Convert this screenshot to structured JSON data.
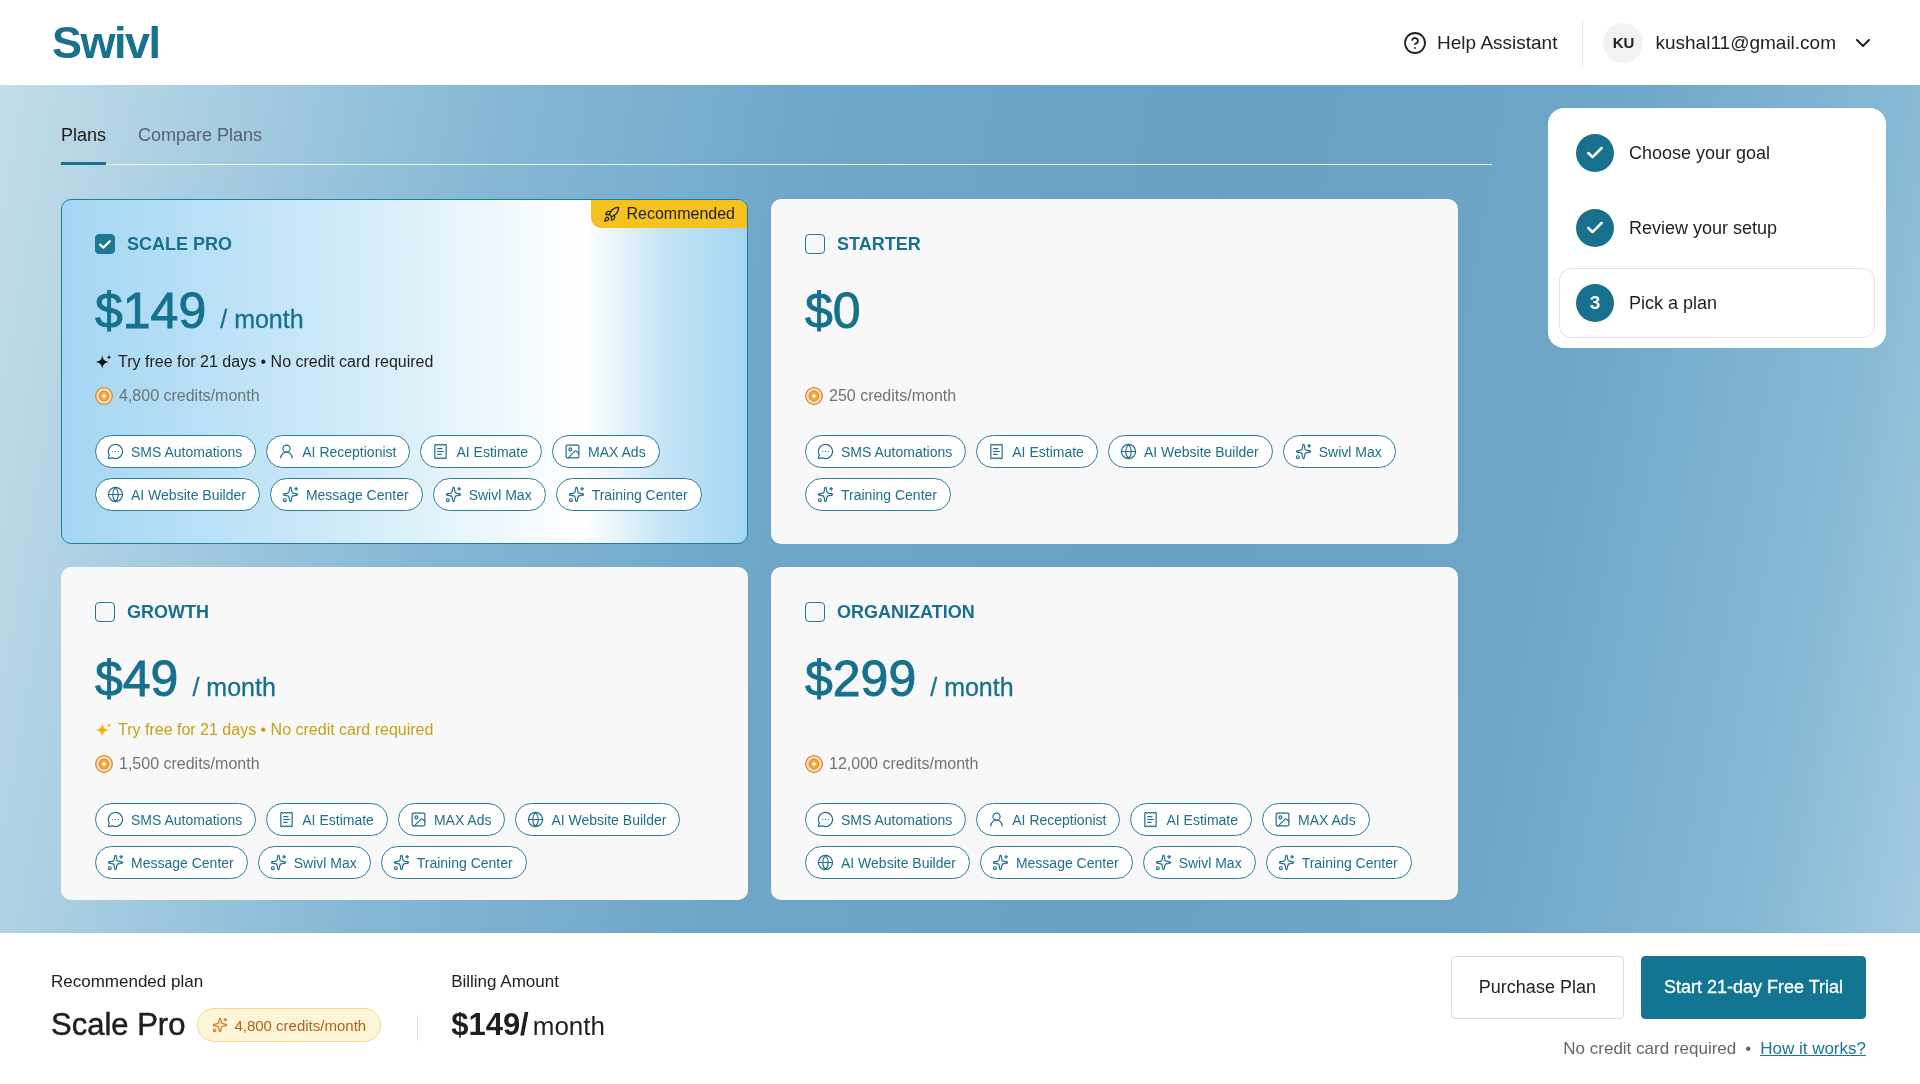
{
  "header": {
    "logo": "Swivl",
    "help": {
      "label": "Help Assistant"
    },
    "user": {
      "initials": "KU",
      "email": "kushal11@gmail.com"
    }
  },
  "tabs": [
    {
      "label": "Plans",
      "selected": true
    },
    {
      "label": "Compare Plans",
      "selected": false
    }
  ],
  "plans": [
    {
      "name": "SCALE PRO",
      "selected": true,
      "badge": "Recommended",
      "price": "$149",
      "period": "/ month",
      "trial": "Try free for 21 days • No credit card required",
      "credits": "4,800 credits/month",
      "features": [
        {
          "label": "SMS Automations",
          "kind": "chat"
        },
        {
          "label": "AI Receptionist",
          "kind": "receptionist"
        },
        {
          "label": "AI Estimate",
          "kind": "estimate"
        },
        {
          "label": "MAX Ads",
          "kind": "ads"
        },
        {
          "label": "AI Website Builder",
          "kind": "website"
        },
        {
          "label": "Message Center",
          "kind": "sparkle"
        },
        {
          "label": "Swivl Max",
          "kind": "sparkle"
        },
        {
          "label": "Training Center",
          "kind": "sparkle"
        }
      ]
    },
    {
      "name": "STARTER",
      "selected": false,
      "price": "$0",
      "credits": "250 credits/month",
      "features": [
        {
          "label": "SMS Automations",
          "kind": "chat"
        },
        {
          "label": "AI Estimate",
          "kind": "estimate"
        },
        {
          "label": "AI Website Builder",
          "kind": "website"
        },
        {
          "label": "Swivl Max",
          "kind": "sparkle"
        },
        {
          "label": "Training Center",
          "kind": "sparkle"
        }
      ]
    },
    {
      "name": "GROWTH",
      "selected": false,
      "price": "$49",
      "period": "/ month",
      "trial": "Try free for 21 days • No credit card required",
      "credits": "1,500 credits/month",
      "features": [
        {
          "label": "SMS Automations",
          "kind": "chat"
        },
        {
          "label": "AI Estimate",
          "kind": "estimate"
        },
        {
          "label": "MAX Ads",
          "kind": "ads"
        },
        {
          "label": "AI Website Builder",
          "kind": "website"
        },
        {
          "label": "Message Center",
          "kind": "sparkle"
        },
        {
          "label": "Swivl Max",
          "kind": "sparkle"
        },
        {
          "label": "Training Center",
          "kind": "sparkle"
        }
      ]
    },
    {
      "name": "ORGANIZATION",
      "selected": false,
      "price": "$299",
      "period": "/ month",
      "credits": "12,000 credits/month",
      "features": [
        {
          "label": "SMS Automations",
          "kind": "chat"
        },
        {
          "label": "AI Receptionist",
          "kind": "receptionist"
        },
        {
          "label": "AI Estimate",
          "kind": "estimate"
        },
        {
          "label": "MAX Ads",
          "kind": "ads"
        },
        {
          "label": "AI Website Builder",
          "kind": "website"
        },
        {
          "label": "Message Center",
          "kind": "sparkle"
        },
        {
          "label": "Swivl Max",
          "kind": "sparkle"
        },
        {
          "label": "Training Center",
          "kind": "sparkle"
        }
      ]
    }
  ],
  "steps": [
    {
      "label": "Choose your goal",
      "done": true,
      "current": false
    },
    {
      "label": "Review your setup",
      "done": true,
      "current": false
    },
    {
      "label": "Pick a plan",
      "number": "3",
      "done": false,
      "current": true
    }
  ],
  "footer": {
    "recommended_label": "Recommended plan",
    "plan_name": "Scale Pro",
    "credits": "4,800 credits/month",
    "billing_label": "Billing Amount",
    "amount": "$149/",
    "period": "month",
    "buttons": [
      {
        "label": "Purchase Plan",
        "kind": "secondary"
      },
      {
        "label": "Start 21-day Free Trial",
        "kind": "primary"
      }
    ],
    "note": "No credit card required",
    "separator": "•",
    "link": "How it works?"
  }
}
